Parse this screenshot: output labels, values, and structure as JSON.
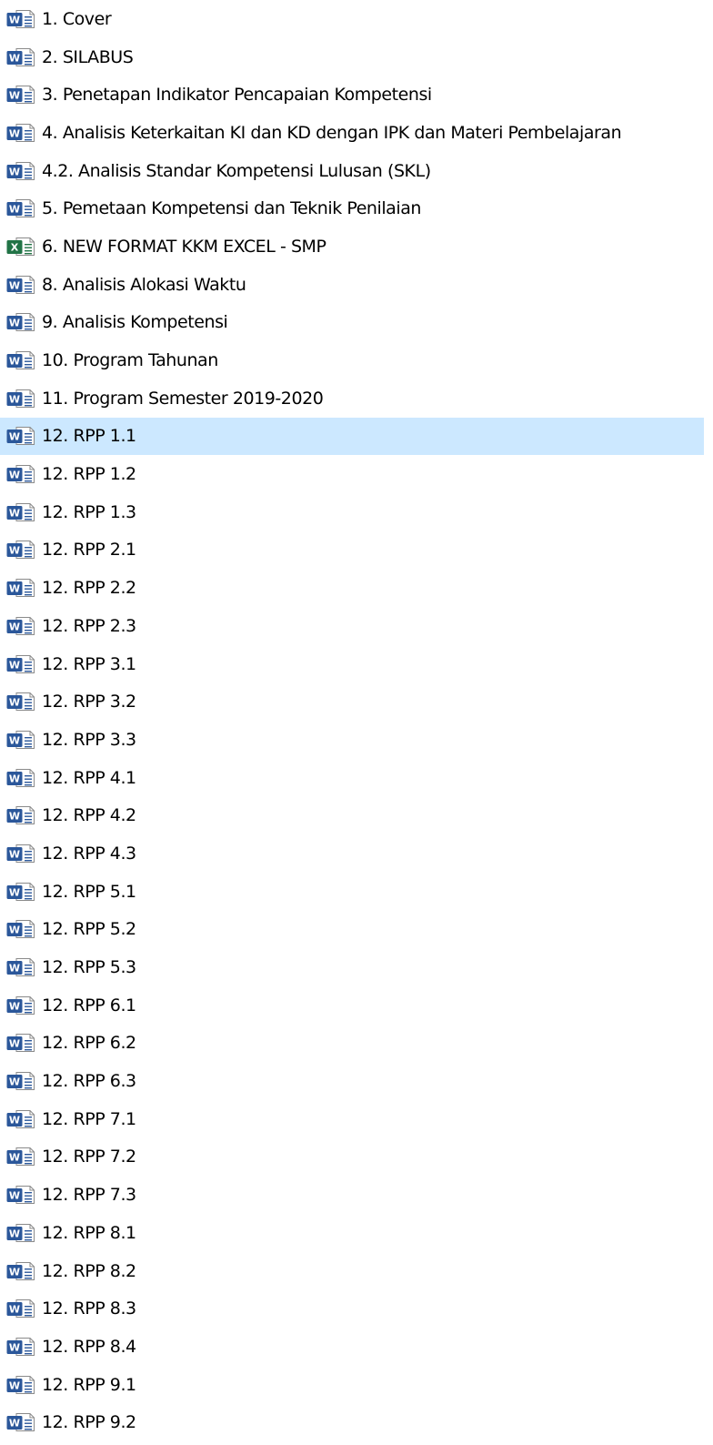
{
  "explorer": {
    "selected_color": "#cce8ff",
    "icons": {
      "word": {
        "name": "word-document-icon",
        "badge": "W",
        "color": "#2b579a"
      },
      "excel": {
        "name": "excel-workbook-icon",
        "badge": "X",
        "color": "#217346"
      }
    },
    "files": [
      {
        "name": "1. Cover",
        "type": "word"
      },
      {
        "name": "2. SILABUS",
        "type": "word"
      },
      {
        "name": "3. Penetapan Indikator Pencapaian Kompetensi",
        "type": "word"
      },
      {
        "name": "4. Analisis Keterkaitan KI dan KD dengan IPK dan Materi Pembelajaran",
        "type": "word"
      },
      {
        "name": "4.2. Analisis Standar Kompetensi Lulusan (SKL)",
        "type": "word"
      },
      {
        "name": "5. Pemetaan Kompetensi dan Teknik Penilaian",
        "type": "word"
      },
      {
        "name": "6. NEW FORMAT KKM EXCEL - SMP",
        "type": "excel"
      },
      {
        "name": "8. Analisis Alokasi Waktu",
        "type": "word"
      },
      {
        "name": "9. Analisis Kompetensi",
        "type": "word"
      },
      {
        "name": "10. Program Tahunan",
        "type": "word"
      },
      {
        "name": "11. Program Semester 2019-2020",
        "type": "word"
      },
      {
        "name": "12. RPP 1.1",
        "type": "word",
        "selected": true
      },
      {
        "name": "12. RPP 1.2",
        "type": "word"
      },
      {
        "name": "12. RPP 1.3",
        "type": "word"
      },
      {
        "name": "12. RPP 2.1",
        "type": "word"
      },
      {
        "name": "12. RPP 2.2",
        "type": "word"
      },
      {
        "name": "12. RPP 2.3",
        "type": "word"
      },
      {
        "name": "12. RPP 3.1",
        "type": "word"
      },
      {
        "name": "12. RPP 3.2",
        "type": "word"
      },
      {
        "name": "12. RPP 3.3",
        "type": "word"
      },
      {
        "name": "12. RPP 4.1",
        "type": "word"
      },
      {
        "name": "12. RPP 4.2",
        "type": "word"
      },
      {
        "name": "12. RPP 4.3",
        "type": "word"
      },
      {
        "name": "12. RPP 5.1",
        "type": "word"
      },
      {
        "name": "12. RPP 5.2",
        "type": "word"
      },
      {
        "name": "12. RPP 5.3",
        "type": "word"
      },
      {
        "name": "12. RPP 6.1",
        "type": "word"
      },
      {
        "name": "12. RPP 6.2",
        "type": "word"
      },
      {
        "name": "12. RPP 6.3",
        "type": "word"
      },
      {
        "name": "12. RPP 7.1",
        "type": "word"
      },
      {
        "name": "12. RPP 7.2",
        "type": "word"
      },
      {
        "name": "12. RPP 7.3",
        "type": "word"
      },
      {
        "name": "12. RPP 8.1",
        "type": "word"
      },
      {
        "name": "12. RPP 8.2",
        "type": "word"
      },
      {
        "name": "12. RPP 8.3",
        "type": "word"
      },
      {
        "name": "12. RPP 8.4",
        "type": "word"
      },
      {
        "name": "12. RPP 9.1",
        "type": "word"
      },
      {
        "name": "12. RPP 9.2",
        "type": "word"
      }
    ]
  }
}
